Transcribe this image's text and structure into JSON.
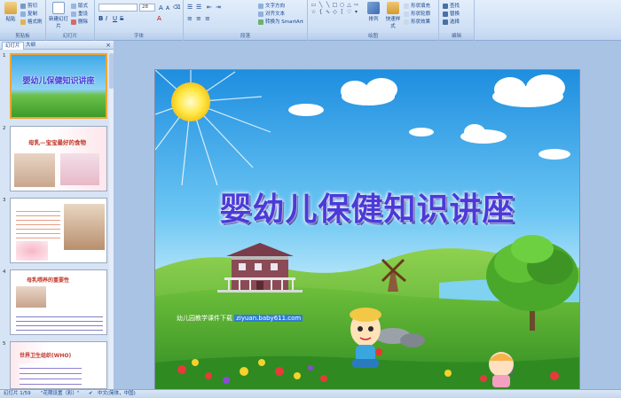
{
  "ribbon": {
    "groups": [
      {
        "label": "剪贴板",
        "buttons": {
          "paste": "粘贴",
          "cut": "剪切",
          "copy": "复制",
          "format_painter": "格式刷"
        }
      },
      {
        "label": "幻灯片",
        "buttons": {
          "new_slide": "新建幻灯片",
          "layout": "版式",
          "reset": "重设",
          "delete": "删除"
        }
      },
      {
        "label": "字体",
        "font_name": "",
        "font_size": "28"
      },
      {
        "label": "段落",
        "buttons": {
          "text_direction": "文字方向",
          "align_text": "对齐文本",
          "smartart": "转换为 SmartArt"
        }
      },
      {
        "label": "绘图",
        "buttons": {
          "arrange": "排列",
          "quick_styles": "快速样式",
          "shape_fill": "形状填充",
          "shape_outline": "形状轮廓",
          "shape_effects": "形状效果"
        }
      },
      {
        "label": "编辑",
        "buttons": {
          "find": "查找",
          "replace": "替换",
          "select": "选择"
        }
      }
    ]
  },
  "pane": {
    "tabs": [
      "幻灯片",
      "大纲"
    ],
    "close": "×",
    "thumbs": [
      {
        "num": "1",
        "title": "婴幼儿保健知识讲座"
      },
      {
        "num": "2",
        "title": "母乳—宝宝最好的食物"
      },
      {
        "num": "3",
        "title": ""
      },
      {
        "num": "4",
        "title": "母乳喂养的重要性"
      },
      {
        "num": "5",
        "title": "世界卫生组织(WHO)"
      }
    ]
  },
  "slide": {
    "title": "婴幼儿保健知识讲座",
    "footer_label": "幼儿园教学课件下载",
    "footer_url": "ziyuan.baby611.com"
  },
  "status": {
    "slide_info": "幻灯片 1/59",
    "theme": "\"花期设置（彩）\"",
    "language": "中文(简体，中国)"
  },
  "colors": {
    "ribbon_bg": "#cfe0f5",
    "pane_bg": "#d7e4f5",
    "selection": "#f0a530",
    "title_color": "#4a3bd8"
  }
}
